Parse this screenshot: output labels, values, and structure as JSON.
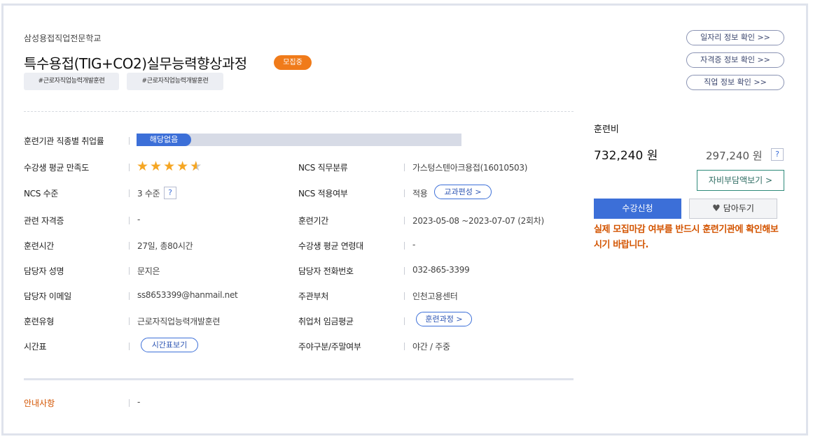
{
  "header": {
    "school": "삼성용접직업전문학교",
    "title": "특수용접(TIG+CO2)실무능력향상과정",
    "status_badge": "모집중",
    "tags": [
      "#근로자직업능력개발훈련",
      "#근로자직업능력개발훈련"
    ]
  },
  "links": {
    "job_info": "일자리 정보 확인 >>",
    "cert_info": "자격증 정보 확인 >>",
    "occupation_info": "직업 정보 확인 >>"
  },
  "details": {
    "employment_rate_label": "훈련기관 직종별 취업률",
    "employment_rate_value": "해당없음",
    "satisfaction_label": "수강생 평균 만족도",
    "satisfaction_rating": 4.5,
    "satisfaction_max": 5,
    "ncs_class_label": "NCS 직무분류",
    "ncs_class_value": "가스텅스텐아크용접(16010503)",
    "ncs_level_label": "NCS 수준",
    "ncs_level_value": "3 수준",
    "help_icon": "?",
    "ncs_apply_label": "NCS 적용여부",
    "ncs_apply_value": "적용",
    "curriculum_button": "교과편성 >",
    "cert_label": "관련 자격증",
    "cert_value": "-",
    "period_label": "훈련기간",
    "period_value": "2023-05-08 ~2023-07-07 (2회차)",
    "hours_label": "훈련시간",
    "hours_value": "27일, 총80시간",
    "age_label": "수강생 평균 연령대",
    "age_value": "-",
    "manager_label": "담당자 성명",
    "manager_value": "문지은",
    "phone_label": "담당자 전화번호",
    "phone_value": "032-865-3399",
    "email_label": "담당자 이메일",
    "email_value": "ss8653399@hanmail.net",
    "dept_label": "주관부처",
    "dept_value": "인천고용센터",
    "type_label": "훈련유형",
    "type_value": "근로자직업능력개발훈련",
    "wage_label": "취업처 임금평균",
    "wage_button": "훈련과정 >",
    "timetable_label": "시간표",
    "timetable_button": "시간표보기",
    "daynight_label": "주야구분/주말여부",
    "daynight_value": "야간 / 주중",
    "notice_label": "안내사항",
    "notice_value": "-"
  },
  "fee": {
    "label": "훈련비",
    "total": "732,240 원",
    "self_pay": "297,240 원",
    "help_icon": "?",
    "self_pay_button": "자비부담액보기 >",
    "apply_button": "수강신청",
    "save_button": "담아두기",
    "warning": "실제 모집마감 여부를 반드시 훈련기관에 확인해보시기 바랍니다."
  },
  "colors": {
    "accent_blue": "#3c6fd8",
    "badge_orange": "#f07b1a",
    "warning_orange": "#d35400",
    "star_gold": "#f5a623"
  }
}
